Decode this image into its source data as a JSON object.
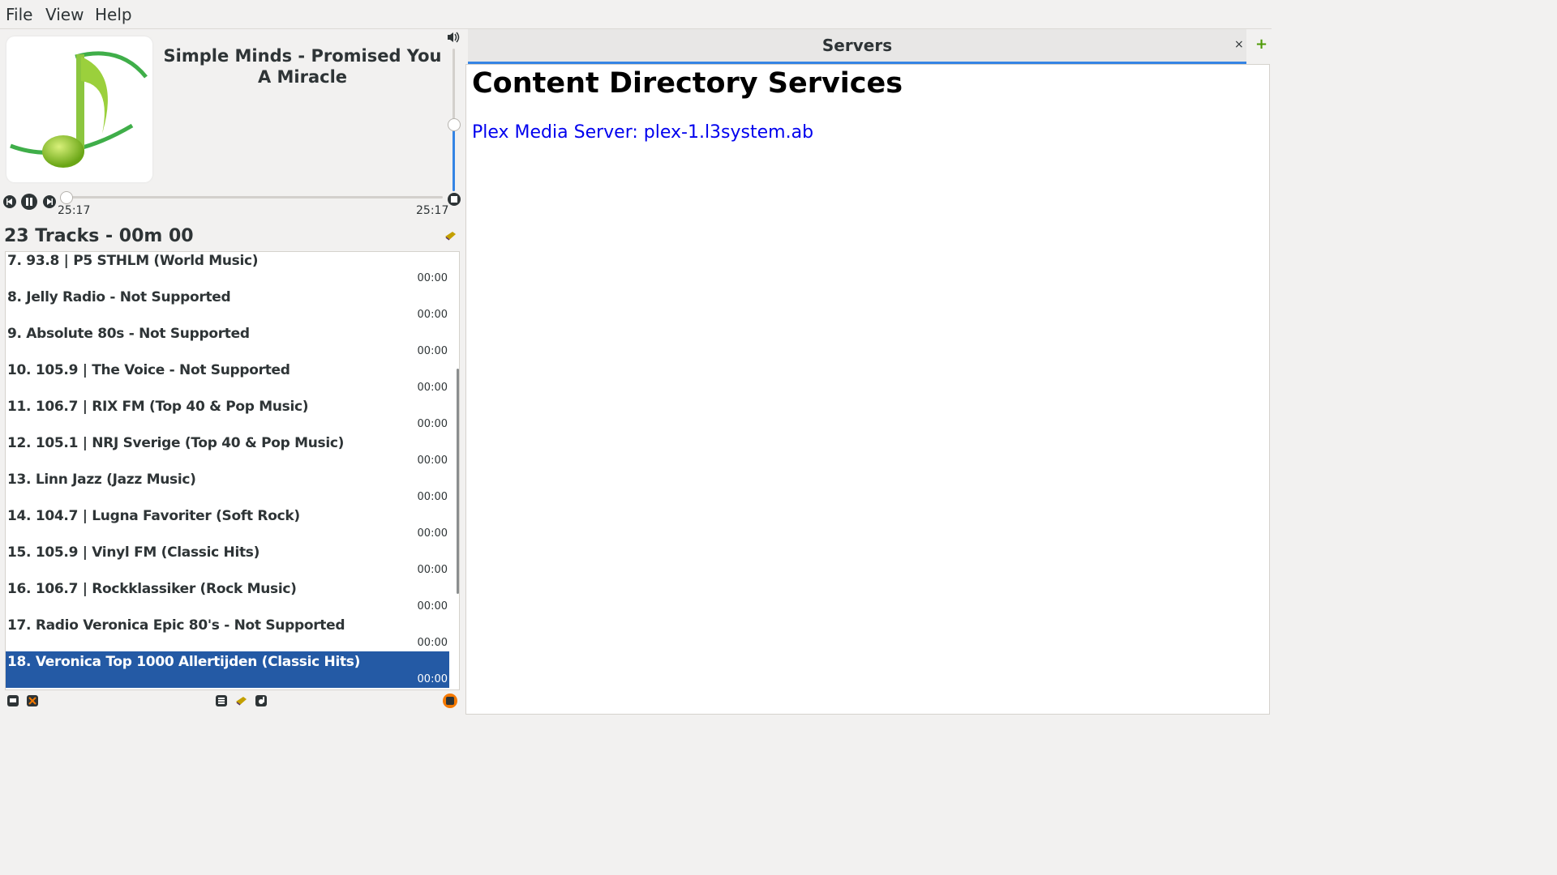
{
  "menu": {
    "items": [
      "File",
      "View",
      "Help"
    ]
  },
  "player": {
    "now_playing": "Simple Minds - Promised You A Miracle",
    "time_elapsed": "25:17",
    "time_total": "25:17",
    "volume_fraction": 0.47,
    "seek_fraction": 0.0
  },
  "playlist": {
    "header": "23 Tracks - 00m 00",
    "rows": [
      {
        "title": "7. 93.8 | P5 STHLM (World Music)",
        "time": "00:00"
      },
      {
        "title": "8. Jelly Radio - Not Supported",
        "time": "00:00"
      },
      {
        "title": "9. Absolute 80s - Not Supported",
        "time": "00:00"
      },
      {
        "title": "10. 105.9 | The Voice - Not Supported",
        "time": "00:00"
      },
      {
        "title": "11. 106.7 | RIX FM (Top 40 & Pop Music)",
        "time": "00:00"
      },
      {
        "title": "12. 105.1 | NRJ Sverige (Top 40 & Pop Music)",
        "time": "00:00"
      },
      {
        "title": "13. Linn Jazz (Jazz Music)",
        "time": "00:00"
      },
      {
        "title": "14. 104.7 | Lugna Favoriter (Soft Rock)",
        "time": "00:00"
      },
      {
        "title": "15. 105.9 | Vinyl FM (Classic Hits)",
        "time": "00:00"
      },
      {
        "title": "16. 106.7 | Rockklassiker (Rock Music)",
        "time": "00:00"
      },
      {
        "title": "17. Radio Veronica Epic 80's - Not Supported",
        "time": "00:00"
      },
      {
        "title": "18. Veronica Top 1000 Allertijden (Classic Hits)",
        "time": "00:00"
      }
    ],
    "selected_index": 11
  },
  "tab": {
    "label": "Servers",
    "close": "×",
    "add": "+"
  },
  "content": {
    "heading": "Content Directory Services",
    "link": "Plex Media Server: plex-1.l3system.ab"
  },
  "colors": {
    "accent": "#3584e4",
    "selection": "#245aa5",
    "link": "#0000ee",
    "add_green": "#4e9a06"
  },
  "icons": [
    "volume-icon",
    "previous-icon",
    "pause-icon",
    "next-icon",
    "stop-icon",
    "clear-playlist-icon",
    "playlist-mode-icon",
    "shuffle-icon",
    "list-icon",
    "broom-icon",
    "dlna-icon",
    "repeat-badge-icon"
  ]
}
